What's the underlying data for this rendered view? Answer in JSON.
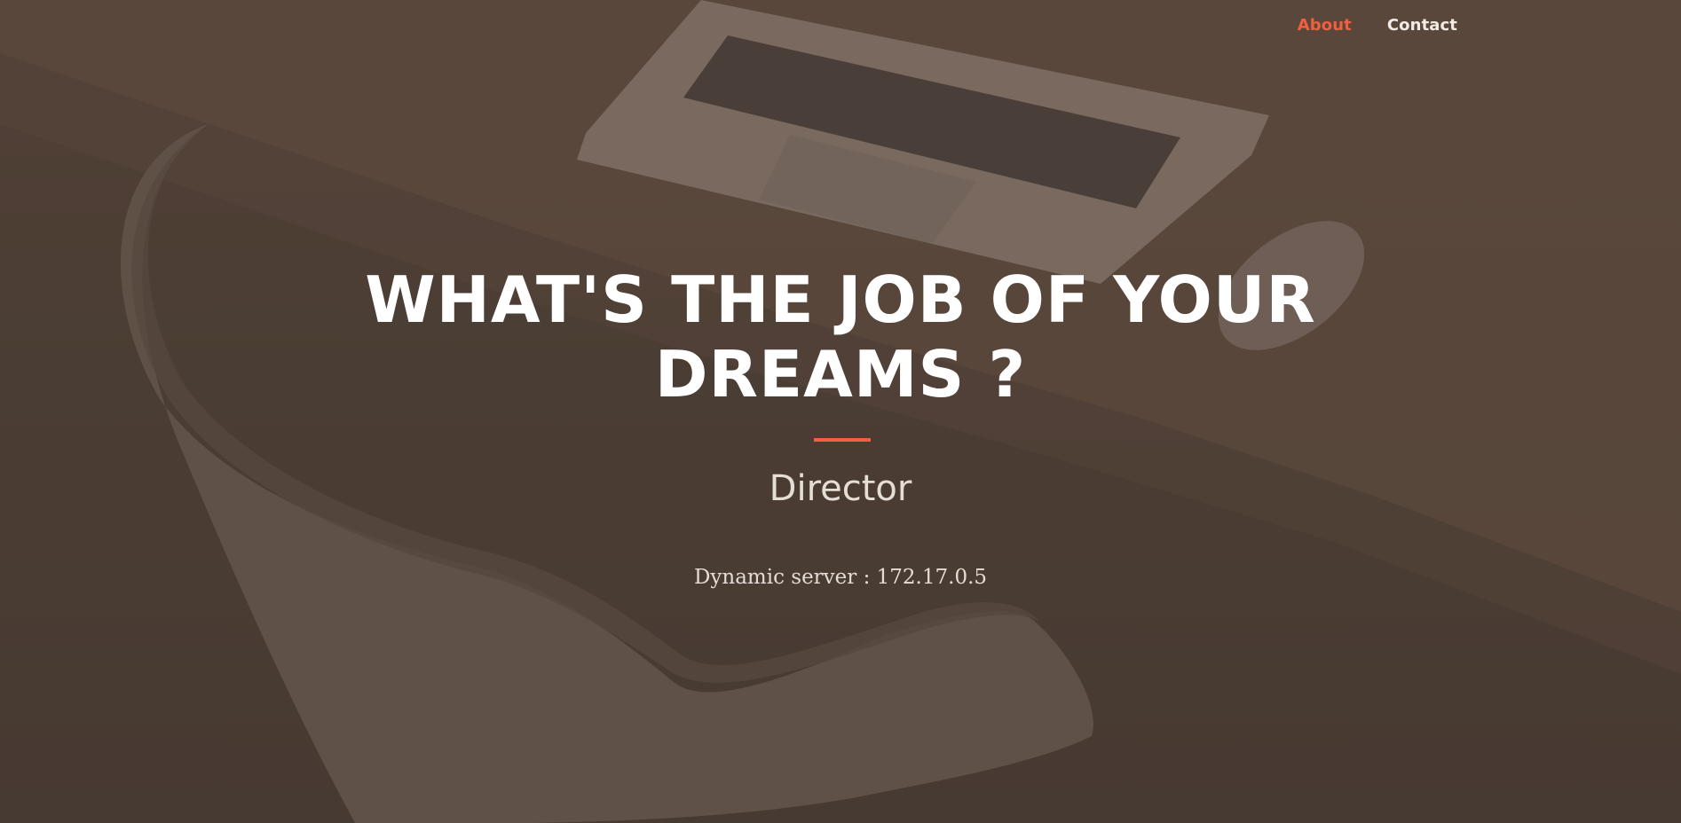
{
  "nav": {
    "items": [
      {
        "label": "About",
        "active": true
      },
      {
        "label": "Contact",
        "active": false
      }
    ]
  },
  "hero": {
    "headline_line1": "WHAT'S THE JOB OF YOUR",
    "headline_line2": "DREAMS ?",
    "job_title": "Director",
    "server_text": "Dynamic server : 172.17.0.5"
  },
  "colors": {
    "accent": "#f05f40",
    "text_primary": "#ffffff",
    "background": "#4c3f36"
  },
  "icons": {
    "background_image": "workspace-photo-laptop-chair-mouse"
  }
}
